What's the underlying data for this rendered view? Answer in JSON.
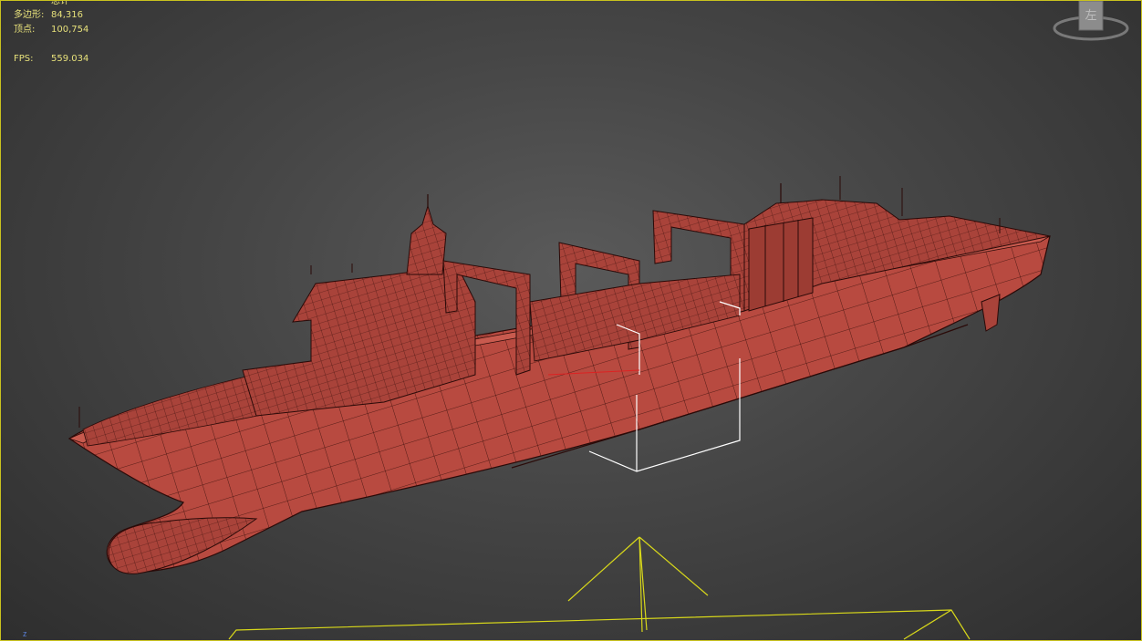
{
  "viewport": {
    "stats": {
      "total_label": "总计",
      "polygons_label": "多边形:",
      "polygons_value": "84,316",
      "vertices_label": "顶点:",
      "vertices_value": "100,754",
      "fps_label": "FPS:",
      "fps_value": "559.034"
    },
    "viewcube": {
      "face_label": "左"
    },
    "axis_label": "z"
  },
  "colors": {
    "viewport_border": "#c9c21e",
    "stats_text": "#e6e07a",
    "model_fill": "#b84a40",
    "wire": "#2a0a08",
    "gizmo_yellow": "#d8d81a"
  },
  "icons": {
    "viewcube": "viewcube-icon",
    "camera": "camera-target-icon"
  }
}
